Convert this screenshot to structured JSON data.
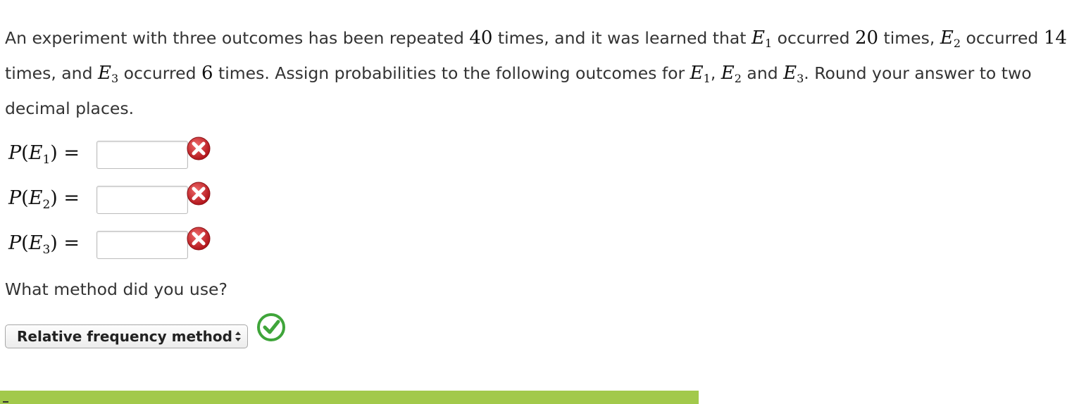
{
  "problem": {
    "t1": "An experiment with three outcomes has been repeated ",
    "n_total": "40",
    "t2": " times, and it was learned that ",
    "e1_letter": "E",
    "e1_sub": "1",
    "t3": " occurred ",
    "n1": "20",
    "t4": " times, ",
    "e2_letter": "E",
    "e2_sub": "2",
    "t5": " occurred ",
    "n2": "14",
    "t6": " times, and ",
    "e3_letter": "E",
    "e3_sub": "3",
    "t7": " occurred ",
    "n3": "6",
    "t8": " times. Assign probabilities to the following outcomes for ",
    "t9": ", ",
    "t10": " and ",
    "t11": ". Round your answer to two decimal places."
  },
  "answers": [
    {
      "p": "P",
      "open": "(",
      "letter": "E",
      "sub": "1",
      "close": ") =",
      "value": "",
      "status_icon": "error-x-icon"
    },
    {
      "p": "P",
      "open": "(",
      "letter": "E",
      "sub": "2",
      "close": ") =",
      "value": "",
      "status_icon": "error-x-icon"
    },
    {
      "p": "P",
      "open": "(",
      "letter": "E",
      "sub": "3",
      "close": ") =",
      "value": "",
      "status_icon": "error-x-icon"
    }
  ],
  "method": {
    "question": "What method did you use?",
    "selected": "Relative frequency method",
    "status_icon": "correct-check-icon"
  },
  "colors": {
    "error_red": "#c2181f",
    "correct_green": "#3fa53a",
    "footer_bar": "#a2c94b"
  }
}
